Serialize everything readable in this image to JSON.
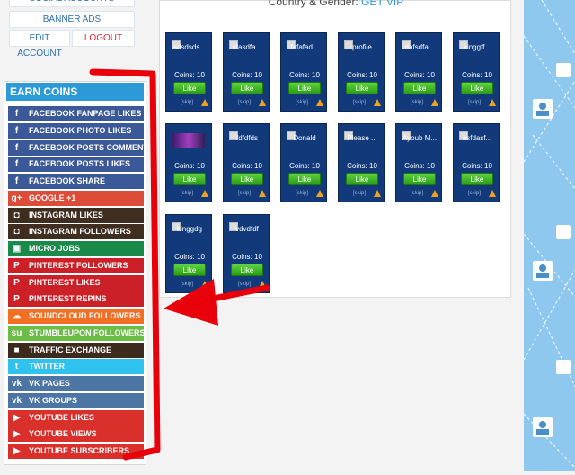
{
  "top_buttons": {
    "social_accounts": "SOCIAL ACCOUNTS",
    "banner_ads": "BANNER ADS",
    "edit_account": "EDIT ACCOUNT",
    "logout": "LOGOUT"
  },
  "earn": {
    "title": "EARN COINS",
    "items": [
      {
        "label": "FACEBOOK FANPAGE LIKES",
        "icon": "facebook-icon",
        "color": "#3b5998"
      },
      {
        "label": "FACEBOOK PHOTO LIKES",
        "icon": "facebook-icon",
        "color": "#3b5998"
      },
      {
        "label": "FACEBOOK POSTS COMMENTS",
        "icon": "facebook-icon",
        "color": "#3b5998"
      },
      {
        "label": "FACEBOOK POSTS LIKES",
        "icon": "facebook-icon",
        "color": "#3b5998"
      },
      {
        "label": "FACEBOOK SHARE",
        "icon": "facebook-icon",
        "color": "#3b5998"
      },
      {
        "label": "GOOGLE +1",
        "icon": "google-plus-icon",
        "color": "#dd4b39"
      },
      {
        "label": "INSTAGRAM LIKES",
        "icon": "instagram-icon",
        "color": "#3f2d20"
      },
      {
        "label": "INSTAGRAM FOLLOWERS",
        "icon": "instagram-icon",
        "color": "#3f2d20"
      },
      {
        "label": "MICRO JOBS",
        "icon": "jobs-icon",
        "color": "#1a8a4a"
      },
      {
        "label": "PINTEREST FOLLOWERS",
        "icon": "pinterest-icon",
        "color": "#cb2027"
      },
      {
        "label": "PINTEREST LIKES",
        "icon": "pinterest-icon",
        "color": "#cb2027"
      },
      {
        "label": "PINTEREST REPINS",
        "icon": "pinterest-icon",
        "color": "#cb2027"
      },
      {
        "label": "SOUNDCLOUD FOLLOWERS",
        "icon": "soundcloud-icon",
        "color": "#f26f23"
      },
      {
        "label": "STUMBLEUPON FOLLOWERS",
        "icon": "stumbleupon-icon",
        "color": "#6bbd45"
      },
      {
        "label": "TRAFFIC EXCHANGE",
        "icon": "traffic-icon",
        "color": "#3b2a1d"
      },
      {
        "label": "TWITTER",
        "icon": "twitter-icon",
        "color": "#2fc2ef"
      },
      {
        "label": "VK PAGES",
        "icon": "vk-icon",
        "color": "#4c75a3"
      },
      {
        "label": "VK GROUPS",
        "icon": "vk-icon",
        "color": "#4c75a3"
      },
      {
        "label": "YOUTUBE LIKES",
        "icon": "youtube-icon",
        "color": "#d9302b"
      },
      {
        "label": "YOUTUBE VIEWS",
        "icon": "youtube-icon",
        "color": "#d9302b"
      },
      {
        "label": "YOUTUBE SUBSCRIBERS",
        "icon": "youtube-icon",
        "color": "#d9302b"
      }
    ]
  },
  "header": {
    "text": "Country & Gender:",
    "vip": "GET VIP"
  },
  "cards": [
    {
      "name": "sdsdsds...",
      "coins": "Coins: 10",
      "like": "Like",
      "skip": "[skip]"
    },
    {
      "name": "sfasdfa...",
      "coins": "Coins: 10",
      "like": "Like",
      "skip": "[skip]"
    },
    {
      "name": "fafafad...",
      "coins": "Coins: 10",
      "like": "Like",
      "skip": "[skip]"
    },
    {
      "name": "profile",
      "coins": "Coins: 10",
      "like": "Like",
      "skip": "[skip]"
    },
    {
      "name": "dafsdfa...",
      "coins": "Coins: 10",
      "like": "Like",
      "skip": "[skip]"
    },
    {
      "name": "kinggff...",
      "coins": "Coins: 10",
      "like": "Like",
      "skip": "[skip]"
    },
    {
      "name": "",
      "coins": "Coins: 10",
      "like": "Like",
      "skip": "[skip]",
      "image": true
    },
    {
      "name": "fdfdfds",
      "coins": "Coins: 10",
      "like": "Like",
      "skip": "[skip]"
    },
    {
      "name": "Donald",
      "coins": "Coins: 10",
      "like": "Like",
      "skip": "[skip]"
    },
    {
      "name": "Please ...",
      "coins": "Coins: 10",
      "like": "Like",
      "skip": "[skip]",
      "wrap": true
    },
    {
      "name": "Ayoub M...",
      "coins": "Coins: 10",
      "like": "Like",
      "skip": "[skip]",
      "wrap": true
    },
    {
      "name": "asfdasf...",
      "coins": "Coins: 10",
      "like": "Like",
      "skip": "[skip]"
    },
    {
      "name": "kinggdg",
      "coins": "Coins: 10",
      "like": "Like",
      "skip": "[skip]"
    },
    {
      "name": "vdvdfdf",
      "coins": "Coins: 10",
      "like": "Like",
      "skip": "[skip]"
    }
  ],
  "colors": {
    "accent": "#2b9ad7",
    "annotation": "#e8000b",
    "card_bg": "#123a7b"
  }
}
